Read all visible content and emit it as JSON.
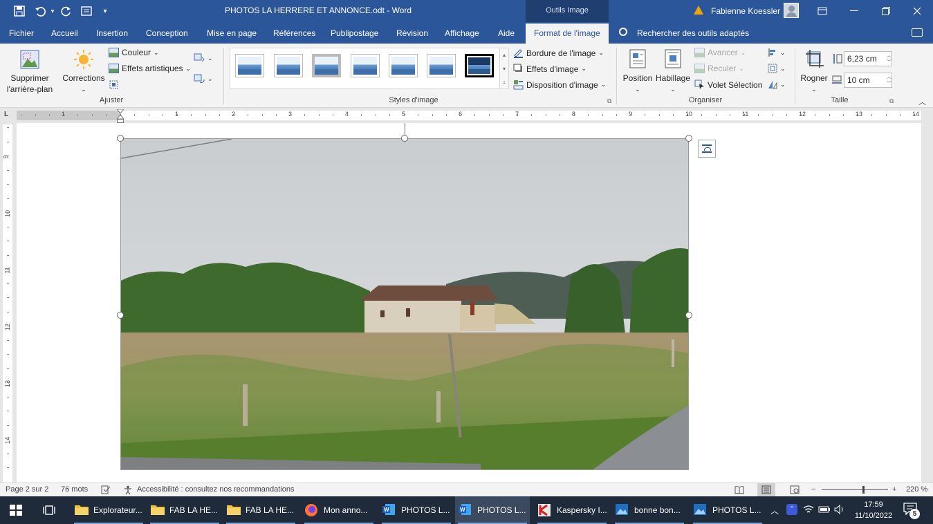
{
  "titlebar": {
    "doc_title": "PHOTOS LA HERRERE ET ANNONCE.odt  -  Word",
    "tools_tab": "Outils Image",
    "user": "Fabienne Koessler"
  },
  "tabs": [
    "Fichier",
    "Accueil",
    "Insertion",
    "Conception",
    "Mise en page",
    "Références",
    "Publipostage",
    "Révision",
    "Affichage",
    "Aide",
    "Format de l'image"
  ],
  "search_tools": "Rechercher des outils adaptés",
  "ribbon": {
    "remove_bg": [
      "Supprimer",
      "l'arrière-plan"
    ],
    "corrections": "Corrections",
    "color": "Couleur",
    "artistic": "Effets artistiques",
    "group_adjust": "Ajuster",
    "group_styles": "Styles d'image",
    "border": "Bordure de l'image",
    "effects": "Effets d'image",
    "layout": "Disposition d'image",
    "position": "Position",
    "wrap": "Habillage",
    "forward": "Avancer",
    "backward": "Reculer",
    "selection_pane": "Volet Sélection",
    "group_arrange": "Organiser",
    "crop": "Rogner",
    "height": "6,23 cm",
    "width": "10 cm",
    "group_size": "Taille"
  },
  "ruler": {
    "numbers": [
      "1",
      "1",
      "2",
      "3",
      "4",
      "5",
      "6",
      "7",
      "8",
      "9",
      "10",
      "11",
      "12",
      "13",
      "14"
    ],
    "corner": "L",
    "vertical": [
      "9",
      "10",
      "11",
      "12",
      "13",
      "14"
    ]
  },
  "status": {
    "page": "Page 2 sur 2",
    "words": "76 mots",
    "accessibility": "Accessibilité : consultez nos recommandations",
    "zoom_minus": "−",
    "zoom_plus": "+",
    "zoom": "220 %"
  },
  "taskbar": {
    "items": [
      {
        "label": "Explorateur...",
        "icon": "folder-icon"
      },
      {
        "label": "FAB LA HE...",
        "icon": "folder-icon"
      },
      {
        "label": "FAB LA HE...",
        "icon": "folder-icon"
      },
      {
        "label": "Mon anno...",
        "icon": "firefox-icon"
      },
      {
        "label": "PHOTOS L...",
        "icon": "word-icon"
      },
      {
        "label": "PHOTOS L...",
        "icon": "word-icon"
      },
      {
        "label": "Kaspersky I...",
        "icon": "kaspersky-icon"
      },
      {
        "label": "bonne bon...",
        "icon": "photos-icon"
      },
      {
        "label": "PHOTOS L...",
        "icon": "photos-icon"
      }
    ],
    "time": "17:59",
    "date": "11/10/2022",
    "notifications": "5"
  },
  "colors": {
    "word_blue": "#2b579a",
    "ribbon_bg": "#f3f3f3",
    "taskbar": "#1f2a3a"
  }
}
